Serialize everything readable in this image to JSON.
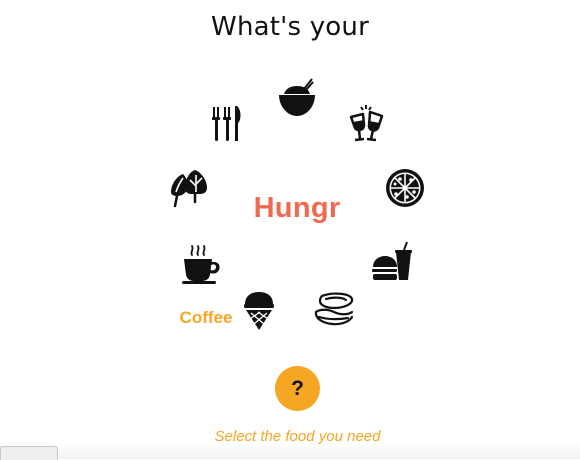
{
  "header": {
    "title": "What's your"
  },
  "center": {
    "brand": "Hungr"
  },
  "selection": {
    "label": "Coffee"
  },
  "help_button": {
    "label": "?"
  },
  "footer": {
    "hint": "Select the food you need"
  },
  "colors": {
    "brand": "#f06a50",
    "accent": "#f5a623",
    "icon": "#111111"
  },
  "icons": [
    "cutlery-icon",
    "rice-bowl-icon",
    "wine-glasses-icon",
    "pizza-icon",
    "fast-food-icon",
    "shellfish-icon",
    "ice-cream-icon",
    "coffee-cup-icon",
    "vegetables-icon"
  ]
}
